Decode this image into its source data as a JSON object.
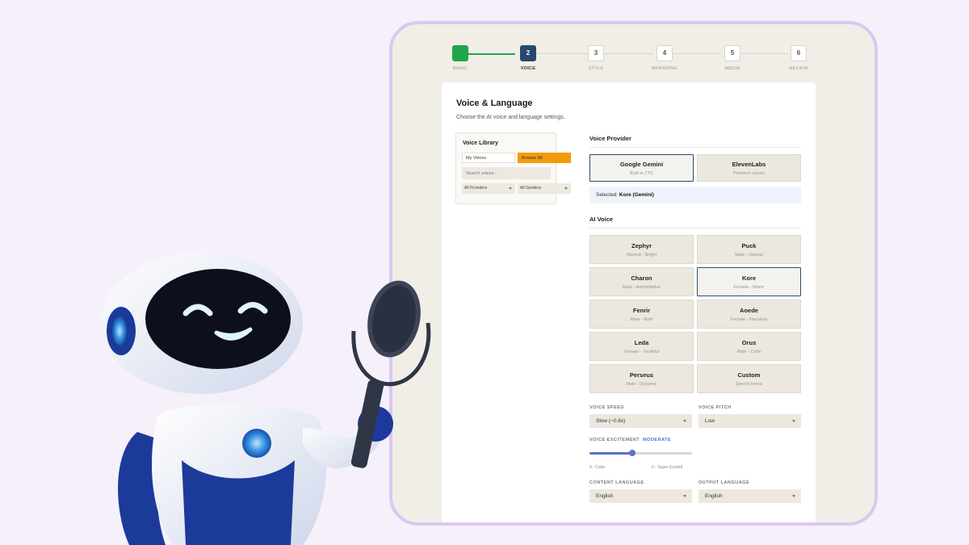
{
  "stepper": {
    "steps": [
      {
        "num": "",
        "label": "BASIC"
      },
      {
        "num": "2",
        "label": "VOICE"
      },
      {
        "num": "3",
        "label": "STYLE"
      },
      {
        "num": "4",
        "label": "BRANDING"
      },
      {
        "num": "5",
        "label": "MEDIA"
      },
      {
        "num": "6",
        "label": "REVIEW"
      }
    ]
  },
  "card": {
    "title": "Voice & Language",
    "subtitle": "Choose the AI voice and language settings."
  },
  "library": {
    "title": "Voice Library",
    "tab_my": "My Voices",
    "tab_browse": "Browse All",
    "search_placeholder": "Search voices...",
    "filter_provider": "All Providers",
    "filter_gender": "All Genders"
  },
  "provider": {
    "title": "Voice Provider",
    "options": [
      {
        "name": "Google Gemini",
        "desc": "Built-in TTS"
      },
      {
        "name": "ElevenLabs",
        "desc": "Premium voices"
      }
    ],
    "selected_prefix": "Selected:",
    "selected_value": "Kore (Gemini)"
  },
  "ai_voice": {
    "title": "AI Voice",
    "voices": [
      {
        "name": "Zephyr",
        "desc": "Neutral - Bright"
      },
      {
        "name": "Puck",
        "desc": "Male - Upbeat"
      },
      {
        "name": "Charon",
        "desc": "Male - Authoritative"
      },
      {
        "name": "Kore",
        "desc": "Female - Warm"
      },
      {
        "name": "Fenrir",
        "desc": "Male - Bold"
      },
      {
        "name": "Aoede",
        "desc": "Female - Narrative"
      },
      {
        "name": "Leda",
        "desc": "Female - Youthful"
      },
      {
        "name": "Orus",
        "desc": "Male - Calm"
      },
      {
        "name": "Perseus",
        "desc": "Male - Dynamic"
      },
      {
        "name": "Custom",
        "desc": "Specify below"
      }
    ]
  },
  "settings": {
    "speed_label": "VOICE SPEED",
    "speed_value": "Slow (~0.8x)",
    "pitch_label": "VOICE PITCH",
    "pitch_value": "Low",
    "excitement_label": "VOICE EXCITEMENT",
    "excitement_value": "MODERATE",
    "excitement_level": 0.42,
    "excitement_min": "0 - Calm",
    "excitement_max": "5 - Super Excited",
    "content_lang_label": "CONTENT LANGUAGE",
    "content_lang_value": "English",
    "output_lang_label": "OUTPUT LANGUAGE",
    "output_lang_value": "English"
  },
  "colors": {
    "accent_green": "#1ea64a",
    "accent_navy": "#27496d",
    "accent_orange": "#f29b0a",
    "slider_blue": "#5a72c8"
  }
}
